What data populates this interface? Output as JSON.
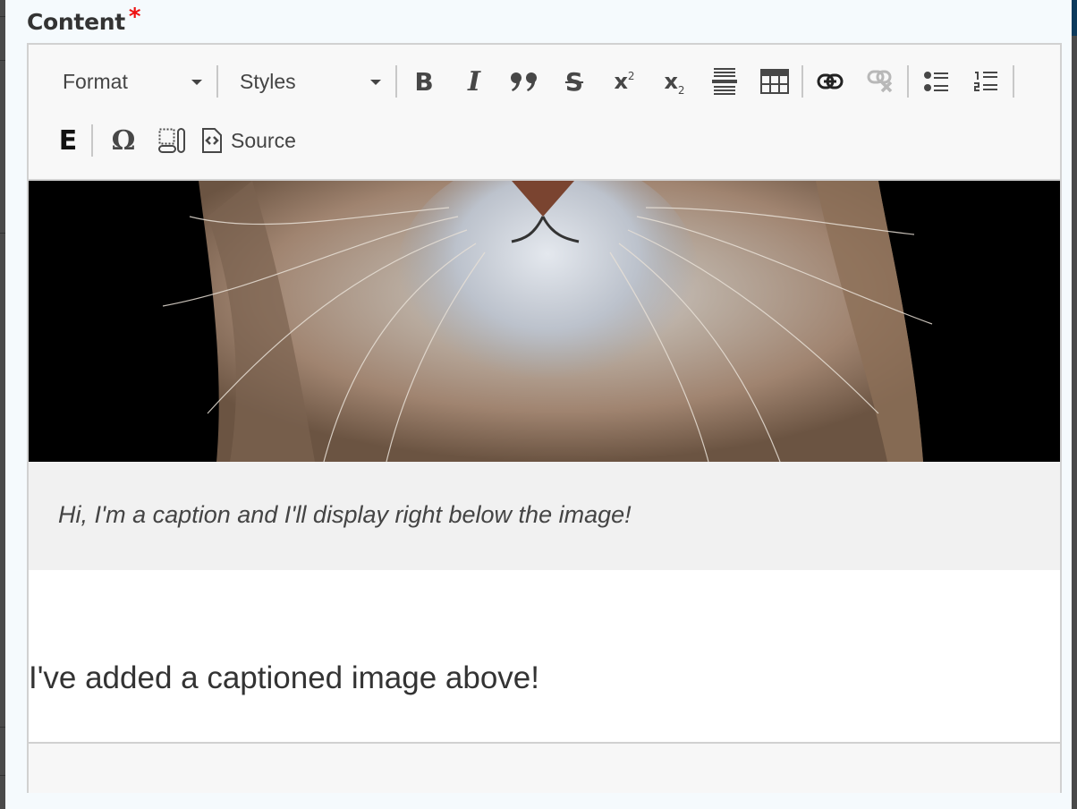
{
  "field": {
    "label": "Content",
    "required_marker": "*"
  },
  "toolbar": {
    "format": {
      "label": "Format",
      "icon": "chevron-down-icon"
    },
    "styles": {
      "label": "Styles",
      "icon": "chevron-down-icon"
    },
    "buttons": [
      {
        "name": "bold",
        "glyph": "B",
        "icon": "bold-icon"
      },
      {
        "name": "italic",
        "glyph": "I",
        "icon": "italic-icon"
      },
      {
        "name": "blockquote",
        "glyph": "”",
        "icon": "blockquote-icon"
      },
      {
        "name": "strikethrough",
        "glyph": "S",
        "icon": "strikethrough-icon"
      },
      {
        "name": "superscript",
        "glyph": "x",
        "sub_glyph": "2",
        "icon": "superscript-icon"
      },
      {
        "name": "subscript",
        "glyph": "x",
        "sub_glyph": "2",
        "icon": "subscript-icon"
      },
      {
        "name": "horizontal-line",
        "icon": "horizontal-line-icon"
      },
      {
        "name": "table",
        "icon": "table-icon"
      },
      {
        "name": "link",
        "icon": "link-icon"
      },
      {
        "name": "unlink",
        "icon": "unlink-icon",
        "disabled": true
      },
      {
        "name": "bulleted-list",
        "icon": "bulleted-list-icon"
      },
      {
        "name": "numbered-list",
        "icon": "numbered-list-icon"
      },
      {
        "name": "embed",
        "glyph": "E",
        "icon": "embed-icon"
      },
      {
        "name": "special-characters",
        "glyph": "Ω",
        "icon": "omega-icon"
      },
      {
        "name": "show-blocks",
        "icon": "show-blocks-icon"
      }
    ],
    "source": {
      "label": "Source",
      "icon": "source-code-icon"
    }
  },
  "content": {
    "image_alt": "Close-up of a cat's chin and whiskers on a black background",
    "caption": "Hi, I'm a caption and I'll display right below the image!",
    "paragraph": "I've added a captioned image above!"
  },
  "colors": {
    "required": "#ee1111",
    "icon": "#474747",
    "icon_disabled": "#b8b8b8",
    "toolbar_bg": "#f8f8f8",
    "caption_bg": "#f1f1f1",
    "page_bg": "#f5fafd"
  }
}
